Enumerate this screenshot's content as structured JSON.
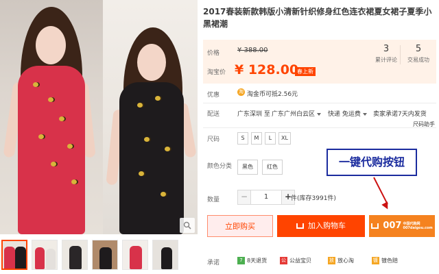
{
  "product": {
    "title": "2017春装新款韩版小清新针织修身红色连衣裙夏女裙子夏季小黑裙潮"
  },
  "price": {
    "label": "价格",
    "old_value": "¥ 388.00",
    "taobao_label": "淘宝价",
    "new_value": "¥ 128.00",
    "promo_tag": "春上新"
  },
  "stats": [
    {
      "num": "3",
      "label": "累计评论"
    },
    {
      "num": "5",
      "label": "交易成功"
    }
  ],
  "discount": {
    "label": "优惠",
    "coin_symbol": "淘",
    "text": "淘金币可抵2.56元"
  },
  "shipping": {
    "label": "配送",
    "from": "广东深圳 至",
    "to": "广东广州白云区",
    "express": "快递 免运费",
    "promise": "卖家承诺7天内发货",
    "help": "尺码助手"
  },
  "size": {
    "label": "尺码",
    "options": [
      "S",
      "M",
      "L",
      "XL"
    ]
  },
  "color": {
    "label": "颜色分类",
    "options": [
      "黑色",
      "红色"
    ]
  },
  "quantity": {
    "label": "数量",
    "minus": "−",
    "value": "1",
    "plus": "+",
    "stock": "件(库存3991件)"
  },
  "annotation": {
    "text": "一键代购按钮"
  },
  "buttons": {
    "buy_now": "立即购买",
    "add_cart": "加入购物车",
    "agent_logo": "007",
    "agent_sub1": "中国代购网",
    "agent_sub2": "007daigou.com"
  },
  "promises": {
    "label": "承诺",
    "items": [
      {
        "icon": "7",
        "label": "8天退货",
        "color": "#4caf50"
      },
      {
        "icon": "公",
        "label": "公益宝贝",
        "color": "#e53935"
      },
      {
        "icon": "放",
        "label": "放心淘",
        "color": "#f5a623"
      },
      {
        "icon": "镀",
        "label": "镀色赔",
        "color": "#f5a623"
      }
    ]
  },
  "colors": {
    "accent": "#ff4400",
    "price_bg": "#fff2e8",
    "annotation": "#1a2b9e",
    "arrow": "#cc1111",
    "agent_button": "#f5821f"
  }
}
